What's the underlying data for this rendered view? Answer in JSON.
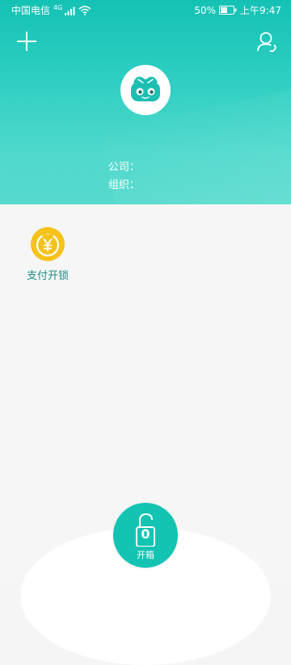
{
  "status_bar": {
    "carrier": "中国电信",
    "network": "4G",
    "battery": "50%",
    "time": "上午9:47"
  },
  "header": {
    "colors": {
      "accent": "#14c2b4",
      "accent_light": "#56dacd"
    },
    "icons": {
      "left": "plus-icon",
      "right": "user-settings-icon",
      "avatar": "robot-avatar-icon"
    },
    "info": {
      "company_label": "公司：",
      "organization_label": "组织："
    }
  },
  "features": [
    {
      "label": "支付开锁",
      "icon": "yen-coin-icon",
      "color": "#f4c21a"
    }
  ],
  "bottom_action": {
    "label": "开箱",
    "lock_value": "0",
    "icon": "unlock-icon",
    "color": "#13c4b3"
  }
}
